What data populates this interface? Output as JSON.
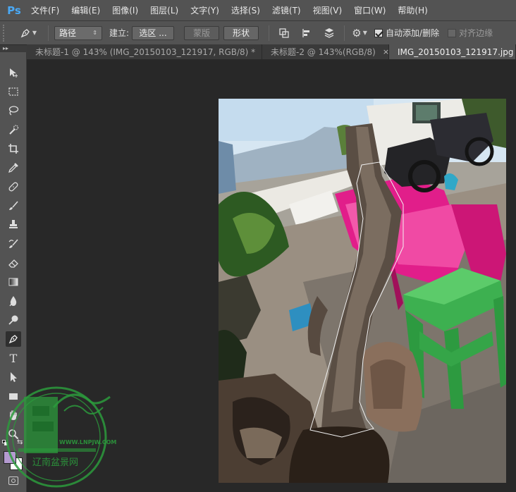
{
  "app": {
    "logo": "Ps"
  },
  "menu": [
    "文件(F)",
    "编辑(E)",
    "图像(I)",
    "图层(L)",
    "文字(Y)",
    "选择(S)",
    "滤镜(T)",
    "视图(V)",
    "窗口(W)",
    "帮助(H)"
  ],
  "options": {
    "tool_icon": "pen-icon",
    "mode_select": "路径",
    "make_label": "建立:",
    "selection_button": "选区 ...",
    "mask_button": "蒙版",
    "shape_button": "形状",
    "auto_add_delete": "自动添加/删除",
    "auto_add_delete_checked": true,
    "align_edges": "对齐边缘",
    "align_edges_checked": false
  },
  "tabs": [
    {
      "title": "未标题-1 @ 143% (IMG_20150103_121917, RGB/8) *",
      "active": false
    },
    {
      "title": "未标题-2 @ 143%(RGB/8)",
      "active": false
    },
    {
      "title": "IMG_20150103_121917.jpg @",
      "active": true
    }
  ],
  "close_glyph": "×",
  "toolbox": {
    "collapse_glyph": "▸▸",
    "type_tool_glyph": "T",
    "tools": [
      "move-tool-icon",
      "marquee-tool-icon",
      "lasso-tool-icon",
      "quick-select-tool-icon",
      "crop-tool-icon",
      "eyedropper-tool-icon",
      "healing-brush-icon",
      "brush-tool-icon",
      "clone-stamp-icon",
      "history-brush-icon",
      "eraser-tool-icon",
      "gradient-tool-icon",
      "blur-tool-icon",
      "dodge-tool-icon",
      "pen-tool-icon",
      "type-tool-icon",
      "path-select-icon",
      "rectangle-tool-icon",
      "hand-tool-icon",
      "zoom-tool-icon"
    ],
    "foreground_color": "#b49ad0",
    "background_color": "#ffffff"
  },
  "watermark": {
    "url_text": "WWW.LNPJW.COM",
    "chinese_text": "辽南盆景网",
    "color": "#2c9a3c"
  }
}
